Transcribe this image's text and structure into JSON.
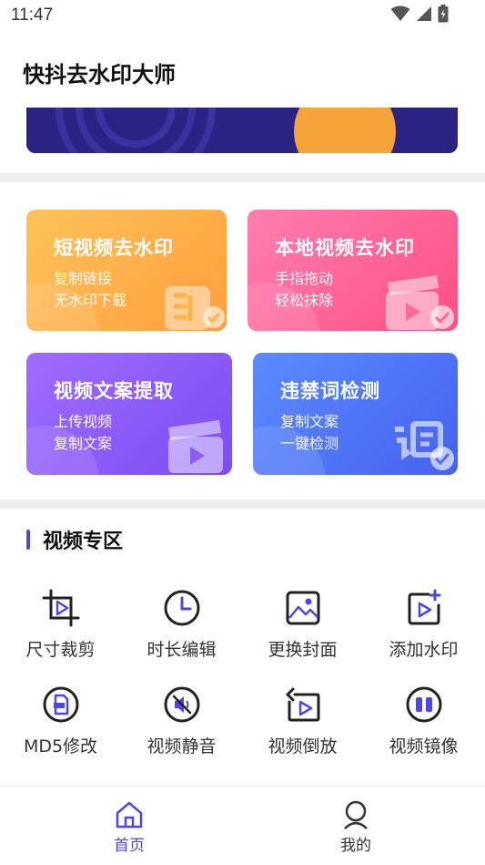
{
  "status_bar": {
    "time": "11:47",
    "icons": [
      "wifi-icon",
      "signal-icon",
      "battery-icon"
    ]
  },
  "app": {
    "title": "快抖去水印大师"
  },
  "colors": {
    "accent": "#4f46e5",
    "card_orange": "#ffb347",
    "card_pink": "#ff5e95",
    "card_purple": "#8b5cf6",
    "card_blue": "#4f6ff5",
    "banner": "#2a2383"
  },
  "feature_cards": [
    {
      "title": "短视频去水印",
      "line1": "复制链接",
      "line2": "无水印下载",
      "icon": "seal-stamp-icon"
    },
    {
      "title": "本地视频去水印",
      "line1": "手指拖动",
      "line2": "轻松抹除",
      "icon": "clapperboard-check-icon"
    },
    {
      "title": "视频文案提取",
      "line1": "上传视频",
      "line2": "复制文案",
      "icon": "clapperboard-icon"
    },
    {
      "title": "违禁词检测",
      "line1": "复制文案",
      "line2": "一键检测",
      "icon": "word-check-icon"
    }
  ],
  "section": {
    "title": "视频专区"
  },
  "tools": [
    {
      "label": "尺寸裁剪",
      "icon": "crop-icon"
    },
    {
      "label": "时长编辑",
      "icon": "clock-icon"
    },
    {
      "label": "更换封面",
      "icon": "image-icon"
    },
    {
      "label": "添加水印",
      "icon": "add-watermark-icon"
    },
    {
      "label": "MD5修改",
      "icon": "md5-file-icon"
    },
    {
      "label": "视频静音",
      "icon": "mute-icon"
    },
    {
      "label": "视频倒放",
      "icon": "reverse-play-icon"
    },
    {
      "label": "视频镜像",
      "icon": "mirror-icon"
    }
  ],
  "tabbar": {
    "items": [
      {
        "label": "首页",
        "icon": "home-icon",
        "active": true
      },
      {
        "label": "我的",
        "icon": "profile-icon",
        "active": false
      }
    ]
  }
}
